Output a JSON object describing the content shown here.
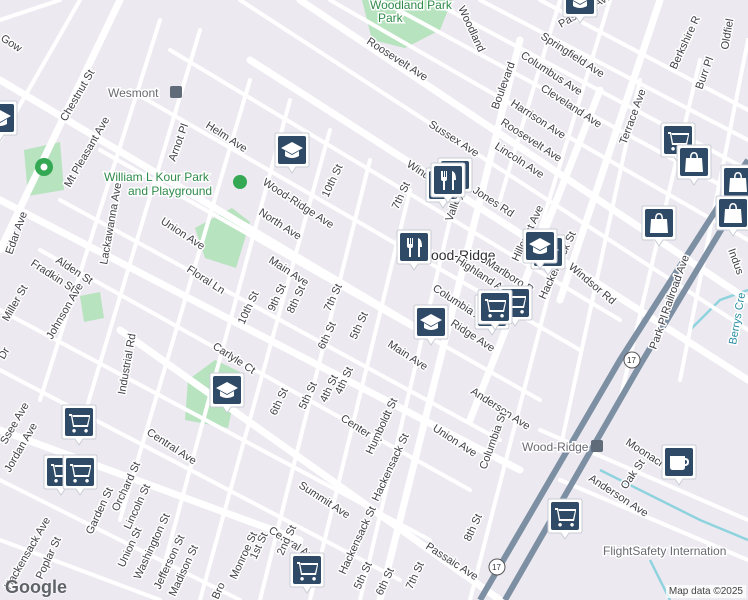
{
  "map": {
    "colors": {
      "background": "#ece9f0",
      "street": "#ffffff",
      "park": "#b7e3bf",
      "rail": "#7d8fa3",
      "water": "#8fd3df",
      "marker": "#2e4a66"
    },
    "attribution": "Map data ©2025",
    "logo": "Google",
    "places": {
      "woodland_park": "Woodland Park",
      "wesmont": "Wesmont",
      "kour_park_line1": "William L Kour Park",
      "kour_park_line2": "and Playground",
      "wood_ridge_town": "Wood-Ridge",
      "wood_ridge_station": "Wood-Ridge",
      "flightsafety": "FlightSafety Internation",
      "berrys_creek": "Berrys Cre"
    },
    "streets": {
      "s1": "Roosevelt Ave",
      "s2": "Woodland",
      "s3": "Springfield Ave",
      "s4": "Columbus Ave",
      "s5": "Passaic Ave",
      "s6": "Berkshire R",
      "s7": "Oldfiel",
      "s8": "Boulevard",
      "s9": "Cleveland Ave",
      "s10": "Harrison Ave",
      "s11": "Burr Pl",
      "s12": "Sussex Ave",
      "s13": "Roosevelt Ave",
      "s14": "Lincoln Ave",
      "s15": "Chestnut St",
      "s16": "Helm Ave",
      "s17": "Arnot Pl",
      "s18": "10th St",
      "s19": "Mt Pleasant Ave",
      "s20": "Wood-Ridge Ave",
      "s21": "7th St",
      "s22": "Windsor",
      "s23": "Jones Rd",
      "s24": "Valley",
      "s25": "Terrace Ave",
      "s26": "Lackawanna Ave",
      "s27": "North Ave",
      "s28": "Union Ave",
      "s29": "Hillcrest Ave",
      "s30": "Hackensack St",
      "s31": "Edar Ave",
      "s32": "Alden St",
      "s33": "Main Ave",
      "s34": "Highland Ave",
      "s35": "Marlboro R",
      "s36": "Windsor Rd",
      "s37": "Railroad Ave",
      "s38": "Indus",
      "s39": "Fradkin St",
      "s40": "Floral Ln",
      "s41": "7th St",
      "s42": "9th St",
      "s43": "8th St",
      "s44": "10th St",
      "s45": "Johnson Ave",
      "s46": "Miller St",
      "s47": "Columbia Ave",
      "s48": "Park Pl",
      "s49": "5th St",
      "s50": "6th St",
      "s51": "Ridge Ave",
      "s52": "Carlyle Ct",
      "s53": "Industrial Rd",
      "s54": "Main Ave",
      "s55": "4th St",
      "s56": "6th St",
      "s57": "5th St",
      "s58": "4th St",
      "s59": "Anderson Ave",
      "s60": "Central Ave",
      "s61": "Center St",
      "s62": "Humboldt St",
      "s63": "Union Ave",
      "s64": "Columbia St",
      "s65": "Moonachie",
      "s66": "Jordan Ave",
      "s67": "Hackensack St",
      "s68": "Orchard St",
      "s69": "Lincoln St",
      "s70": "Oak St",
      "s71": "Anderson Ave",
      "s72": "Garden St",
      "s73": "Summit Ave",
      "s74": "Hackensack Ave",
      "s75": "Union St",
      "s76": "Washington St",
      "s77": "Jefferson St",
      "s78": "Monroe St",
      "s79": "Central Ave",
      "s80": "1st St",
      "s81": "2nd St",
      "s82": "Poplar St",
      "s83": "Madison St",
      "s84": "Passaic Ave",
      "s85": "8th St",
      "s86": "5th St",
      "s87": "6th St",
      "s88": "Hackensack St",
      "s89": "7th St",
      "s90": "Gow",
      "s91": "Ssee Ave",
      "s92": "Dr",
      "s93": "Bro",
      "s94": "17",
      "s95": "17",
      "s96": "17"
    }
  }
}
